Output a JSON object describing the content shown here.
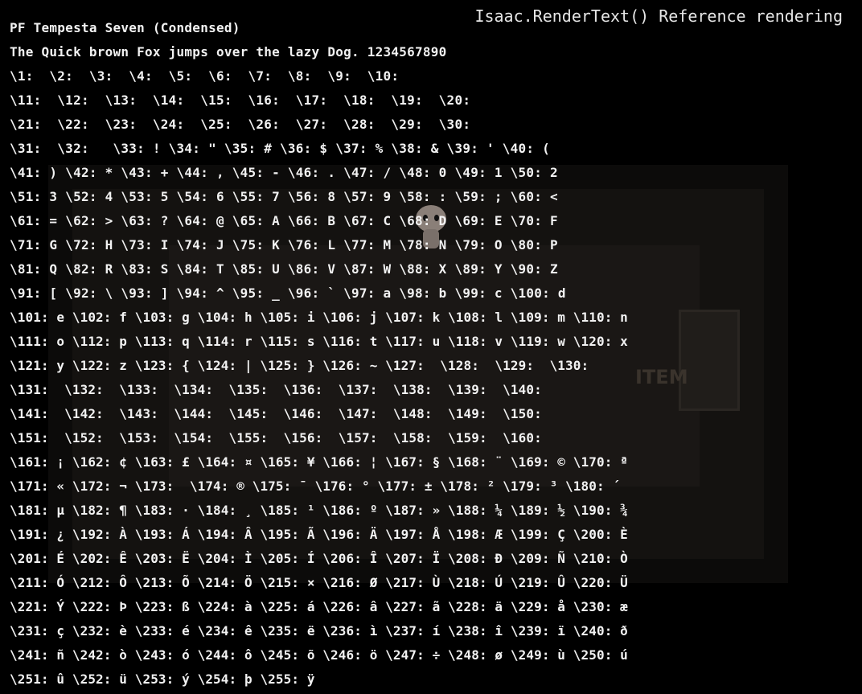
{
  "header": {
    "title": "Isaac.RenderText() Reference rendering"
  },
  "room": {
    "floor_label": "ITEM"
  },
  "lines": [
    "PF Tempesta Seven (Condensed)",
    "The Quick brown Fox jumps over the lazy Dog. 1234567890",
    "\\1:  \\2:  \\3:  \\4:  \\5:  \\6:  \\7:  \\8:  \\9:  \\10:",
    "\\11:  \\12:  \\13:  \\14:  \\15:  \\16:  \\17:  \\18:  \\19:  \\20:",
    "\\21:  \\22:  \\23:  \\24:  \\25:  \\26:  \\27:  \\28:  \\29:  \\30:",
    "\\31:  \\32:   \\33: ! \\34: \" \\35: # \\36: $ \\37: % \\38: & \\39: ' \\40: (",
    "\\41: ) \\42: * \\43: + \\44: , \\45: - \\46: . \\47: / \\48: 0 \\49: 1 \\50: 2",
    "\\51: 3 \\52: 4 \\53: 5 \\54: 6 \\55: 7 \\56: 8 \\57: 9 \\58: : \\59: ; \\60: <",
    "\\61: = \\62: > \\63: ? \\64: @ \\65: A \\66: B \\67: C \\68: D \\69: E \\70: F",
    "\\71: G \\72: H \\73: I \\74: J \\75: K \\76: L \\77: M \\78: N \\79: O \\80: P",
    "\\81: Q \\82: R \\83: S \\84: T \\85: U \\86: V \\87: W \\88: X \\89: Y \\90: Z",
    "\\91: [ \\92: \\ \\93: ] \\94: ^ \\95: _ \\96: ` \\97: a \\98: b \\99: c \\100: d",
    "\\101: e \\102: f \\103: g \\104: h \\105: i \\106: j \\107: k \\108: l \\109: m \\110: n",
    "\\111: o \\112: p \\113: q \\114: r \\115: s \\116: t \\117: u \\118: v \\119: w \\120: x",
    "\\121: y \\122: z \\123: { \\124: | \\125: } \\126: ~ \\127:  \\128:  \\129:  \\130:",
    "\\131:  \\132:  \\133:  \\134:  \\135:  \\136:  \\137:  \\138:  \\139:  \\140:",
    "\\141:  \\142:  \\143:  \\144:  \\145:  \\146:  \\147:  \\148:  \\149:  \\150:",
    "\\151:  \\152:  \\153:  \\154:  \\155:  \\156:  \\157:  \\158:  \\159:  \\160:",
    "\\161: ¡ \\162: ¢ \\163: £ \\164: ¤ \\165: ¥ \\166: ¦ \\167: § \\168: ¨ \\169: © \\170: ª",
    "\\171: « \\172: ¬ \\173:  \\174: ® \\175: ¯ \\176: ° \\177: ± \\178: ² \\179: ³ \\180: ´",
    "\\181: µ \\182: ¶ \\183: · \\184: ¸ \\185: ¹ \\186: º \\187: » \\188: ¼ \\189: ½ \\190: ¾",
    "\\191: ¿ \\192: À \\193: Á \\194: Â \\195: Ã \\196: Ä \\197: Å \\198: Æ \\199: Ç \\200: È",
    "\\201: É \\202: Ê \\203: Ë \\204: Ì \\205: Í \\206: Î \\207: Ï \\208: Ð \\209: Ñ \\210: Ò",
    "\\211: Ó \\212: Ô \\213: Õ \\214: Ö \\215: × \\216: Ø \\217: Ù \\218: Ú \\219: Û \\220: Ü",
    "\\221: Ý \\222: Þ \\223: ß \\224: à \\225: á \\226: â \\227: ã \\228: ä \\229: å \\230: æ",
    "\\231: ç \\232: è \\233: é \\234: ê \\235: ë \\236: ì \\237: í \\238: î \\239: ï \\240: ð",
    "\\241: ñ \\242: ò \\243: ó \\244: ô \\245: õ \\246: ö \\247: ÷ \\248: ø \\249: ù \\250: ú",
    "\\251: û \\252: ü \\253: ý \\254: þ \\255: ÿ"
  ]
}
